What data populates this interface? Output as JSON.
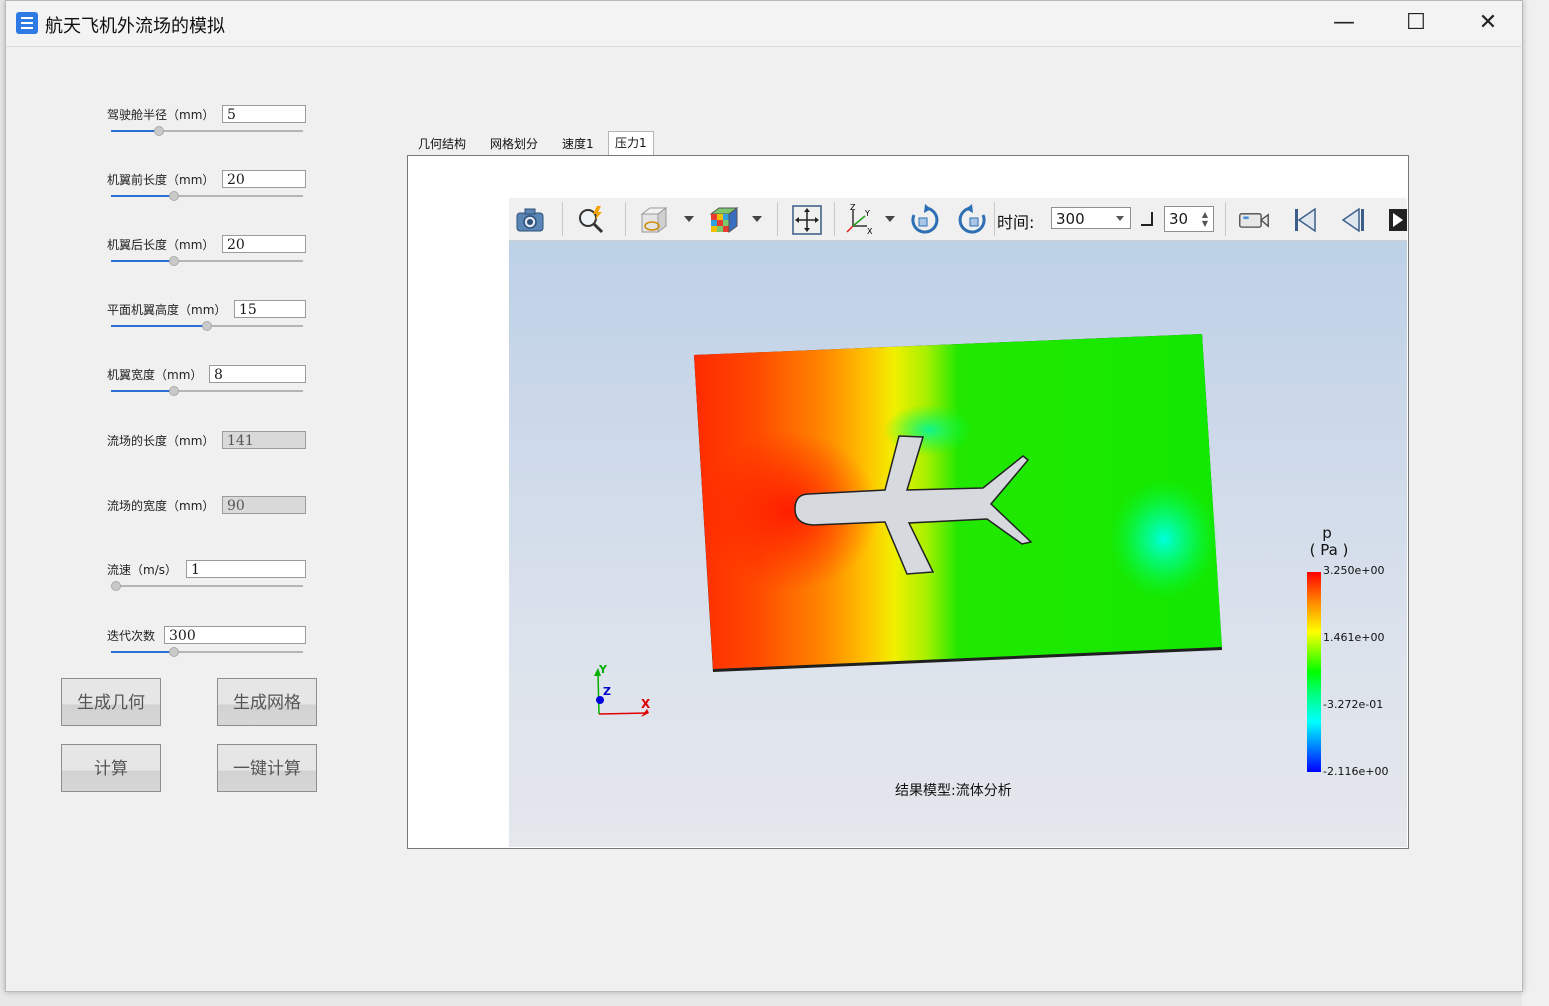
{
  "window": {
    "title": "航天飞机外流场的模拟",
    "minimize_glyph": "—",
    "maximize_glyph": "☐",
    "close_glyph": "✕"
  },
  "params": [
    {
      "label": "驾驶舱半径（mm）",
      "value": "5",
      "disabled": false,
      "slider": 0.25
    },
    {
      "label": "机翼前长度（mm）",
      "value": "20",
      "disabled": false,
      "slider": 0.33
    },
    {
      "label": "机翼后长度（mm）",
      "value": "20",
      "disabled": false,
      "slider": 0.33
    },
    {
      "label": "平面机翼高度（mm）",
      "value": "15",
      "disabled": false,
      "slider": 0.5
    },
    {
      "label": "机翼宽度（mm）",
      "value": "8",
      "disabled": false,
      "slider": 0.33
    },
    {
      "label": "流场的长度（mm）",
      "value": "141",
      "disabled": true,
      "slider": null
    },
    {
      "label": "流场的宽度（mm）",
      "value": "90",
      "disabled": true,
      "slider": null
    },
    {
      "label": "流速（m/s）",
      "value": "1",
      "disabled": false,
      "slider": 0.0
    },
    {
      "label": "迭代次数",
      "value": "300",
      "disabled": false,
      "slider": 0.33
    }
  ],
  "buttons": {
    "gen_geometry": "生成几何",
    "gen_mesh": "生成网格",
    "compute": "计算",
    "one_click": "一键计算"
  },
  "tabs": [
    {
      "label": "几何结构",
      "active": false
    },
    {
      "label": "网格划分",
      "active": false
    },
    {
      "label": "速度1",
      "active": false
    },
    {
      "label": "压力1",
      "active": true
    }
  ],
  "toolbar": {
    "icons": [
      "camera-icon",
      "zoom-icon",
      "display-mode-icon",
      "color-cube-icon",
      "fit-view-icon",
      "axes-orient-icon",
      "rotate-cw-icon",
      "rotate-ccw-icon",
      "video-icon",
      "first-frame-icon",
      "prev-frame-icon",
      "next-frame-icon"
    ],
    "time_label": "时间:",
    "time_value": "300",
    "step_value": "30"
  },
  "colors": {
    "accent": "#2a6fd6",
    "app_icon": "#2f7be6"
  },
  "legend": {
    "title_top": "p",
    "title_unit": "( Pa )",
    "ticks": [
      "3.250e+00",
      "1.461e+00",
      "-3.272e-01",
      "-2.116e+00"
    ]
  },
  "axes": {
    "x": "X",
    "y": "Y",
    "z": "Z"
  },
  "caption": "结果模型:流体分析"
}
